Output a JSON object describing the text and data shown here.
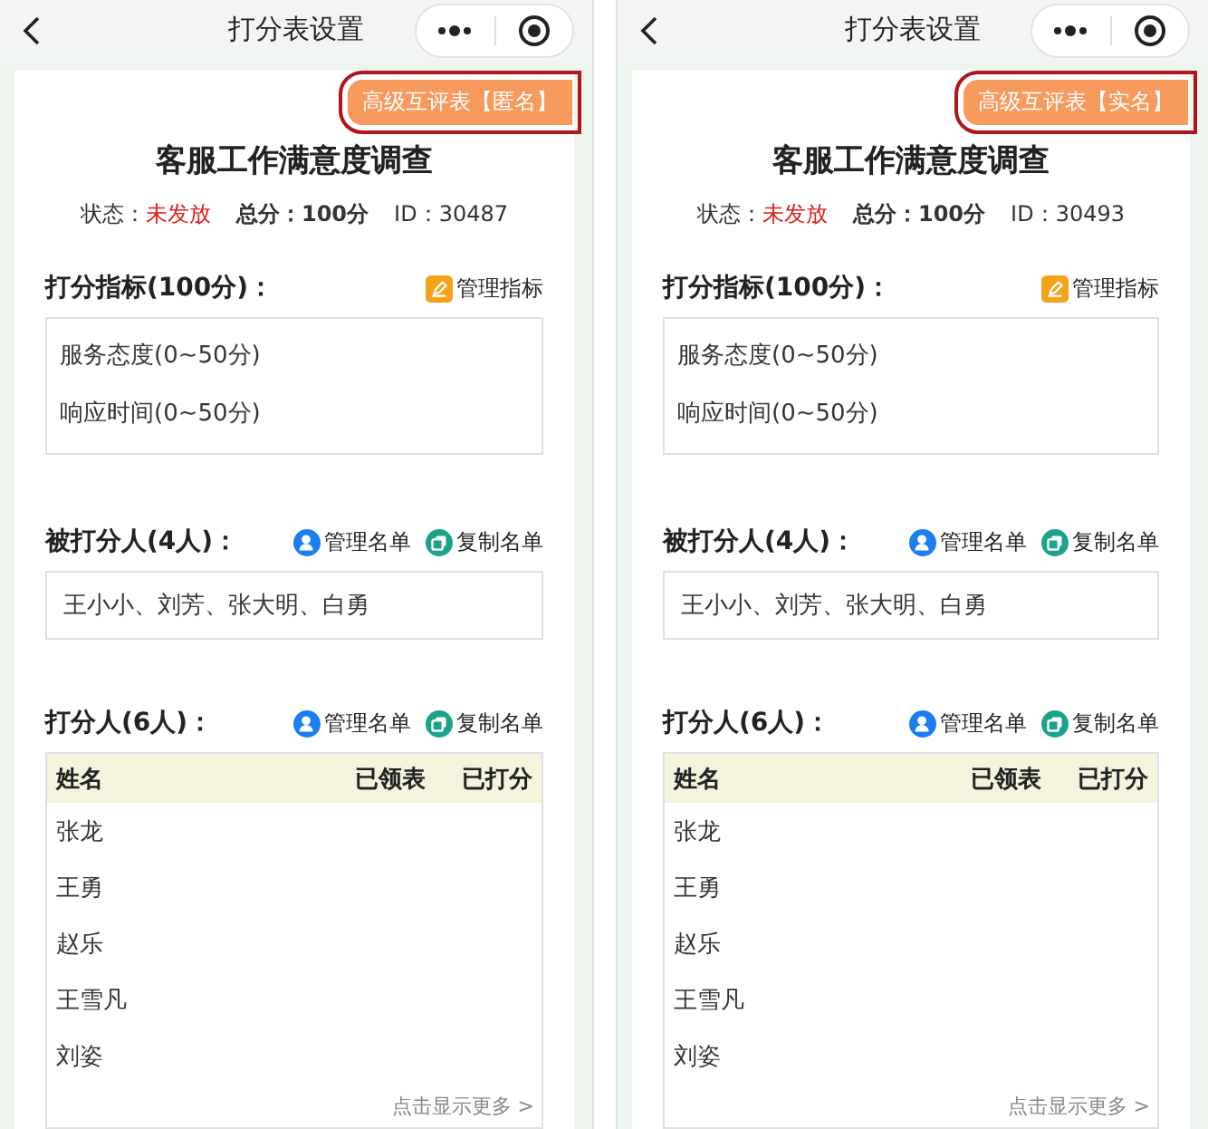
{
  "screens": [
    {
      "nav_title": "打分表设置",
      "tag": {
        "label": "高级互评表【匿名】",
        "highlighted": true
      },
      "title": "客服工作满意度调查",
      "meta": {
        "status_label": "状态：",
        "status_value": "未发放",
        "total": "总分：100分",
        "id": "ID：30487"
      },
      "criteria": {
        "heading": "打分指标(100分)：",
        "action": "管理指标",
        "items": [
          "服务态度(0~50分)",
          "响应时间(0~50分)"
        ]
      },
      "scorees": {
        "heading": "被打分人(4人)：",
        "actions": [
          "管理名单",
          "复制名单"
        ],
        "names": "王小小、刘芳、张大明、白勇"
      },
      "scorers": {
        "heading": "打分人(6人)：",
        "actions": [
          "管理名单",
          "复制名单"
        ],
        "columns": [
          "姓名",
          "已领表",
          "已打分"
        ],
        "rows": [
          "张龙",
          "王勇",
          "赵乐",
          "王雪凡",
          "刘姿"
        ],
        "more": "点击显示更多 >"
      }
    },
    {
      "nav_title": "打分表设置",
      "tag": {
        "label": "高级互评表【实名】",
        "highlighted": true
      },
      "title": "客服工作满意度调查",
      "meta": {
        "status_label": "状态：",
        "status_value": "未发放",
        "total": "总分：100分",
        "id": "ID：30493"
      },
      "criteria": {
        "heading": "打分指标(100分)：",
        "action": "管理指标",
        "items": [
          "服务态度(0~50分)",
          "响应时间(0~50分)"
        ]
      },
      "scorees": {
        "heading": "被打分人(4人)：",
        "actions": [
          "管理名单",
          "复制名单"
        ],
        "names": "王小小、刘芳、张大明、白勇"
      },
      "scorers": {
        "heading": "打分人(6人)：",
        "actions": [
          "管理名单",
          "复制名单"
        ],
        "columns": [
          "姓名",
          "已领表",
          "已打分"
        ],
        "rows": [
          "张龙",
          "王勇",
          "赵乐",
          "王雪凡",
          "刘姿"
        ],
        "more": "点击显示更多 >"
      }
    }
  ]
}
